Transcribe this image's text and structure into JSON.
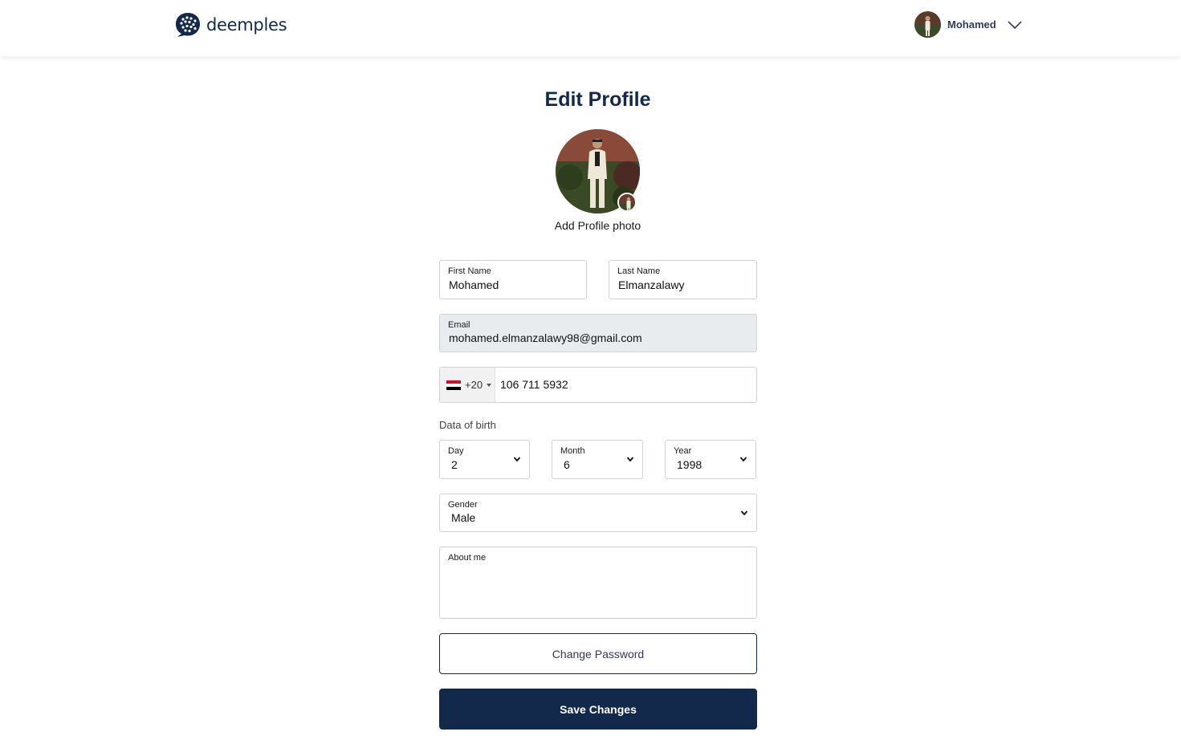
{
  "header": {
    "logo_text": "deemples",
    "user_name": "Mohamed"
  },
  "page": {
    "title": "Edit Profile",
    "add_photo_label": "Add Profile photo"
  },
  "form": {
    "first_name": {
      "label": "First Name",
      "value": "Mohamed"
    },
    "last_name": {
      "label": "Last Name",
      "value": "Elmanzalawy"
    },
    "email": {
      "label": "Email",
      "value": "mohamed.elmanzalawy98@gmail.com"
    },
    "phone": {
      "country_code": "+20",
      "number": "106 711 5932",
      "flag_icon": "egypt-flag-icon"
    },
    "dob_label": "Data of birth",
    "day": {
      "label": "Day",
      "value": "2"
    },
    "month": {
      "label": "Month",
      "value": "6"
    },
    "year": {
      "label": "Year",
      "value": "1998"
    },
    "gender": {
      "label": "Gender",
      "value": "Male"
    },
    "about": {
      "label": "About me",
      "value": ""
    }
  },
  "buttons": {
    "change_password": "Change Password",
    "save_changes": "Save Changes"
  },
  "colors": {
    "brand_navy": "#13294b",
    "readonly_bg": "#e9ecef",
    "border": "#cfd3da"
  }
}
